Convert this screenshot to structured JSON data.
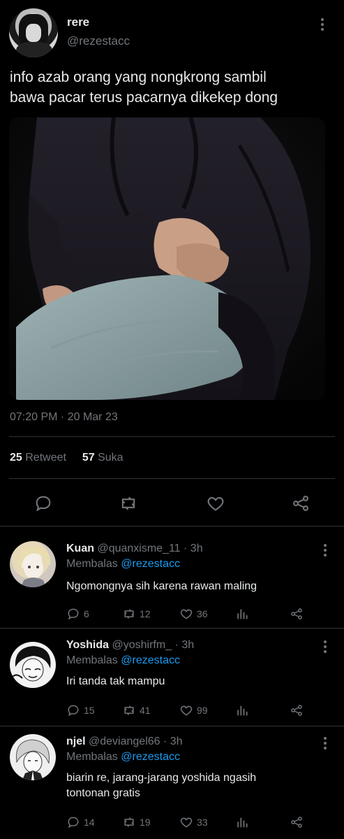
{
  "tweet": {
    "author_name": "rere",
    "author_handle": "@rezestacc",
    "text_line1": "info azab orang yang nongkrong sambil",
    "text_line2": "bawa pacar terus pacarnya dikekep dong",
    "timestamp": "07:20 PM · 20 Mar 23",
    "retweet_count": "25",
    "retweet_label": "Retweet",
    "like_count": "57",
    "like_label": "Suka"
  },
  "replies": [
    {
      "name": "Kuan",
      "handle_time": "@quanxisme_11 · 3h",
      "replying_prefix": "Membalas",
      "replying_to": "@rezestacc",
      "text": "Ngomongnya sih karena rawan maling",
      "reply_count": "6",
      "retweet_count": "12",
      "like_count": "36"
    },
    {
      "name": "Yoshida",
      "handle_time": "@yoshirfm_ · 3h",
      "replying_prefix": "Membalas",
      "replying_to": "@rezestacc",
      "text": "Iri tanda tak mampu",
      "reply_count": "15",
      "retweet_count": "41",
      "like_count": "99"
    },
    {
      "name": "njel",
      "handle_time": "@deviangel66 · 3h",
      "replying_prefix": "Membalas",
      "replying_to": "@rezestacc",
      "text_line1": "biarin re, jarang-jarang yoshida ngasih",
      "text_line2": "tontonan gratis",
      "reply_count": "14",
      "retweet_count": "19",
      "like_count": "33"
    }
  ],
  "colors": {
    "background": "#000000",
    "text": "#e7e9ea",
    "muted": "#71767b",
    "accent": "#1d9bf0",
    "divider": "#2f3336"
  },
  "icons": [
    "more-icon",
    "reply-icon",
    "retweet-icon",
    "like-icon",
    "share-icon",
    "analytics-icon"
  ]
}
